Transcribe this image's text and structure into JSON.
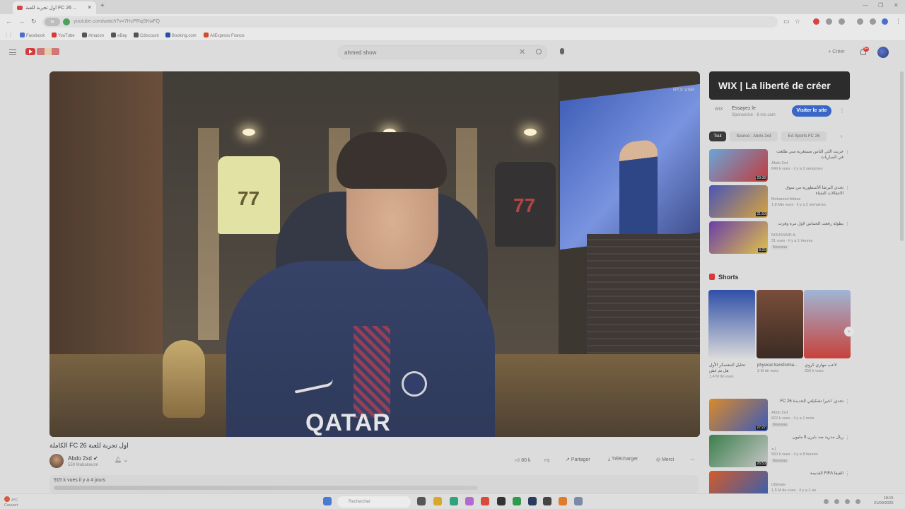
{
  "browser": {
    "tab_title": "اول تجربة للعبة FC 26 ...",
    "url": "youtube.com/watch?v=7HzPRqSKwFQ",
    "site_chip": "⇆"
  },
  "bookmarks": [
    {
      "label": "Facebook",
      "color": "#4a6fd1"
    },
    {
      "label": "YouTube",
      "color": "#d63b3b"
    },
    {
      "label": "Amazon",
      "color": "#555555"
    },
    {
      "label": "eBay",
      "color": "#555555"
    },
    {
      "label": "Cdiscount",
      "color": "#555555"
    },
    {
      "label": "Booking.com",
      "color": "#2b4fa8"
    },
    {
      "label": "AliExpress France",
      "color": "#d24b2b"
    }
  ],
  "header": {
    "search_query": "ahmed show",
    "create_label": "Créer",
    "notification_count": "9+"
  },
  "video": {
    "title": "اول تجربة للعبة FC 26 الكاملة",
    "overlay_badge": "RTX VSR",
    "shirt_number": "77",
    "sponsor_text": "QATAR",
    "channel_name": "Abdo 2xd",
    "subscribers": "559 Mabakeunn",
    "likes": "80 k",
    "share_label": "Partager",
    "download_label": "Télécharger",
    "thanks_label": "Merci",
    "meta": "915 k vues  il y a 4 jours"
  },
  "ad": {
    "headline": "WIX | La liberté de créer",
    "logo": "WIX",
    "line1": "Essayez le",
    "line2": "Sponsorisé · 6 mo cam",
    "cta": "Visiter le site"
  },
  "chips": [
    "Tout",
    "Source : Abdo 2xd",
    "EA Sports FC 26"
  ],
  "recommendations": [
    {
      "title": "جربت اللي الناس مستغربة مني طلعت في المباريات",
      "channel": "Abdo 2xd",
      "meta": "849 k vues · il y a 2 semaines",
      "duration": "29:38",
      "c1": "#6aa4d9",
      "c2": "#c23b3b"
    },
    {
      "title": "تحدي البرشا الأسطورية من سوق الانتقالات الشتاء",
      "channel": "Mohamed Abbas",
      "meta": "1,8 Mio vues · il y a 2 semaines",
      "duration": "21:59",
      "c1": "#4a55b8",
      "c2": "#d8a43c"
    },
    {
      "title": "بطولة رفعت الحماس لاول مره وفزت",
      "channel": "NOUSSAIR A.",
      "meta": "31 vues · il y a 1 heures",
      "duration": "8:25",
      "c1": "#6b3fa8",
      "c2": "#e0c24a",
      "badge": "Nouveau"
    },
    {
      "title": "تحدي: اخيرا تشكيلتي الجديدة FC 26",
      "channel": "Abdo 2xd",
      "meta": "822 k vues · il y a 1 mois",
      "duration": "27:27",
      "c1": "#d88a2a",
      "c2": "#3c5bb8",
      "badge": "Nouveau"
    },
    {
      "title": "ريال مدريد ضد بايرن 8 مليون",
      "channel": "إبه",
      "meta": "560 k vues · il y a 8 heures",
      "duration": "26:53",
      "c1": "#3b7f4b",
      "c2": "#c6c6c6",
      "badge": "Nouveau"
    },
    {
      "title": "الفيفا FIFA القديمة",
      "channel": "Ultimate",
      "meta": "1,5 M de vues · il y a 1 an",
      "duration": "",
      "c1": "#d25b2b",
      "c2": "#2e5fb8"
    }
  ],
  "shorts": {
    "heading": "Shorts",
    "items": [
      {
        "caption": "تحليل المعسكر الأول هل تم غش",
        "views": "1,4 M de vues",
        "c1": "#2f4fa8",
        "c2": "#d9d9d9"
      },
      {
        "caption": "physical transforma...",
        "views": "3 M de vues",
        "c1": "#7a4e3a",
        "c2": "#3a2b24"
      },
      {
        "caption": "لاعب مهاري كروي",
        "views": "256 k vues",
        "c1": "#9fb6d6",
        "c2": "#c8413a"
      }
    ]
  },
  "taskbar": {
    "weather": "4°C",
    "weather_desc": "Couvert",
    "search_placeholder": "Rechercher",
    "time": "18:15",
    "date": "21/09/2025"
  }
}
